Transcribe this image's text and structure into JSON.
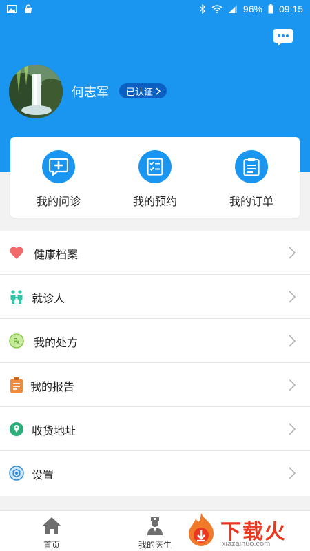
{
  "status_bar": {
    "battery": "96%",
    "time": "09:15",
    "icons": [
      "image-icon",
      "bag-icon",
      "bluetooth-icon",
      "wifi-icon",
      "signal-icon",
      "battery-icon"
    ]
  },
  "header": {
    "bg_color": "#1a96f0",
    "chat_icon": "message-dots-icon",
    "user_name": "何志军",
    "verify_label": "已认证"
  },
  "actions": [
    {
      "label": "我的问诊",
      "icon": "consult-icon"
    },
    {
      "label": "我的预约",
      "icon": "checklist-icon"
    },
    {
      "label": "我的订单",
      "icon": "clipboard-icon"
    }
  ],
  "menu": [
    {
      "label": "健康档案",
      "icon": "heart-icon",
      "color": "#f26a6a"
    },
    {
      "label": "就诊人",
      "icon": "people-icon",
      "color": "#2ec4a6"
    },
    {
      "label": "我的处方",
      "icon": "prescription-icon",
      "color": "#8ccc4a"
    },
    {
      "label": "我的报告",
      "icon": "report-icon",
      "color": "#f08a3c"
    },
    {
      "label": "收货地址",
      "icon": "location-pin-icon",
      "color": "#2bb07a"
    },
    {
      "label": "设置",
      "icon": "settings-icon",
      "color": "#2a8ad6"
    }
  ],
  "tabbar": [
    {
      "label": "首页",
      "icon": "home-icon"
    },
    {
      "label": "我的医生",
      "icon": "doctor-icon"
    }
  ],
  "watermark": {
    "text": "下载火",
    "sub": "xiazaihuo.com"
  }
}
